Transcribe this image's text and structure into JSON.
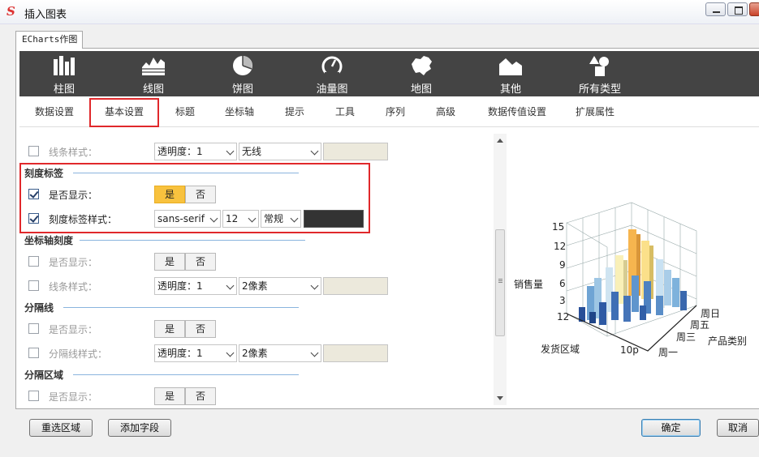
{
  "window": {
    "title": "插入图表"
  },
  "outer_tab": "ECharts作图",
  "chart_types": [
    {
      "label": "柱图",
      "icon": "bar-chart-icon"
    },
    {
      "label": "线图",
      "icon": "line-chart-icon"
    },
    {
      "label": "饼图",
      "icon": "pie-chart-icon"
    },
    {
      "label": "油量图",
      "icon": "gauge-icon"
    },
    {
      "label": "地图",
      "icon": "map-icon"
    },
    {
      "label": "其他",
      "icon": "other-chart-icon"
    },
    {
      "label": "所有类型",
      "icon": "all-types-icon"
    }
  ],
  "sub_tabs": [
    "数据设置",
    "基本设置",
    "标题",
    "坐标轴",
    "提示",
    "工具",
    "序列",
    "高级",
    "数据传值设置",
    "扩展属性"
  ],
  "active_sub_tab": "基本设置",
  "settings": {
    "line_style": {
      "label": "线条样式：",
      "checked": false,
      "opacity_value": "透明度：1",
      "style_value": "无线"
    },
    "tick_labels": {
      "title": "刻度标签",
      "show": {
        "label": "是否显示：",
        "checked": true,
        "yes": "是",
        "no": "否",
        "selected": "是"
      },
      "style": {
        "label": "刻度标签样式：",
        "checked": true,
        "font": "sans-serif",
        "size": "12",
        "weight": "常规",
        "color": "#333333"
      }
    },
    "axis_ticks": {
      "title": "坐标轴刻度",
      "show": {
        "label": "是否显示：",
        "checked": false,
        "yes": "是",
        "no": "否"
      },
      "line_style": {
        "label": "线条样式：",
        "checked": false,
        "opacity_value": "透明度：1",
        "width_value": "2像素"
      }
    },
    "split_line": {
      "title": "分隔线",
      "show": {
        "label": "是否显示：",
        "checked": false,
        "yes": "是",
        "no": "否"
      },
      "style": {
        "label": "分隔线样式：",
        "checked": false,
        "opacity_value": "透明度：1",
        "width_value": "2像素"
      }
    },
    "split_area": {
      "title": "分隔区域",
      "show": {
        "label": "是否显示：",
        "checked": false,
        "yes": "是",
        "no": "否"
      }
    }
  },
  "preview": {
    "y_label": "销售量",
    "x_label": "发货区域",
    "z_label": "产品类别",
    "y_ticks": [
      "15",
      "12",
      "9",
      "6",
      "3"
    ],
    "z_ticks": [
      "周日",
      "周五",
      "周三",
      "周一"
    ],
    "x_tick_first": "12",
    "x_tick_last": "10p"
  },
  "bottom": {
    "reselect": "重选区域",
    "add_field": "添加字段",
    "ok": "确定",
    "cancel": "取消"
  },
  "colors": {
    "accent_red": "#e0282b",
    "selected_yellow": "#f8c23e",
    "strip_bg": "#444444"
  }
}
